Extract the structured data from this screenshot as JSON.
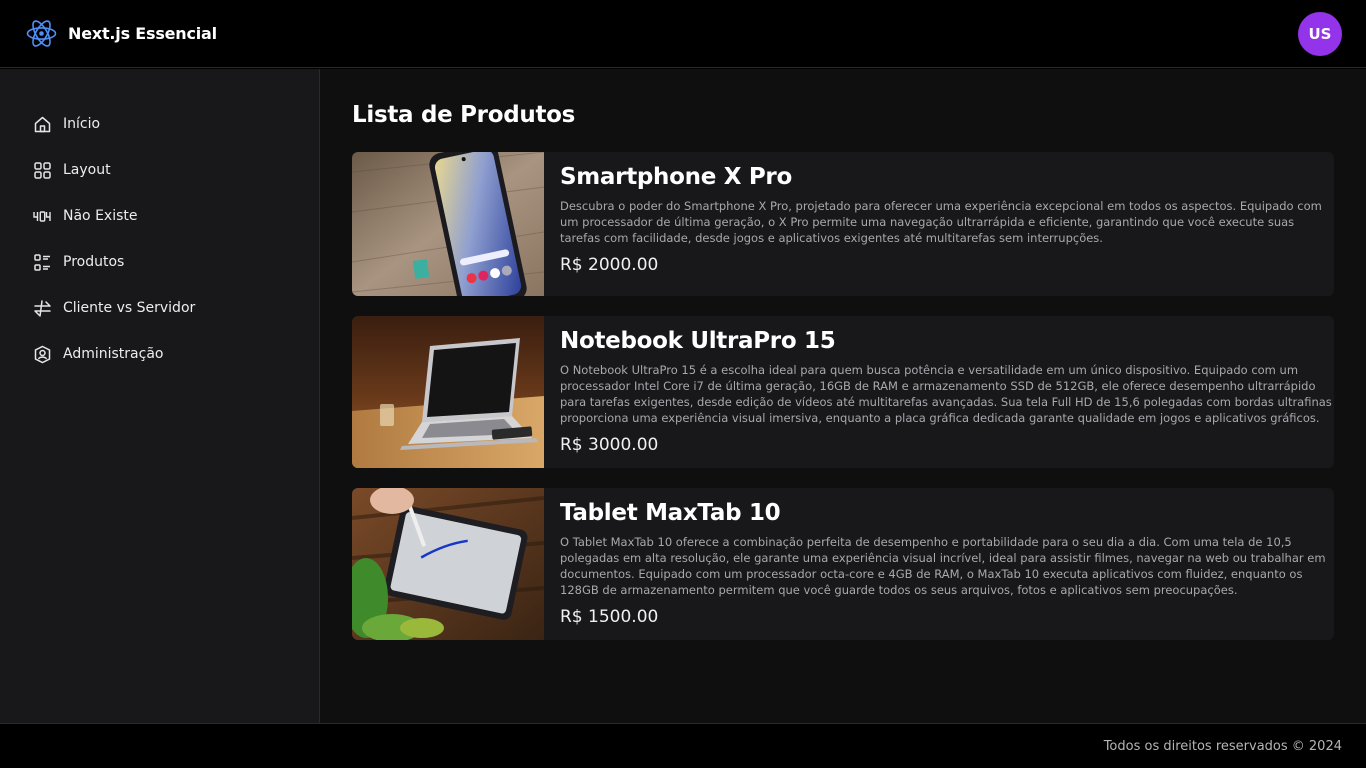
{
  "header": {
    "title": "Next.js Essencial",
    "avatar_initials": "US",
    "avatar_color": "#9333ea"
  },
  "sidebar": {
    "items": [
      {
        "label": "Início",
        "icon": "home-icon"
      },
      {
        "label": "Layout",
        "icon": "grid-icon"
      },
      {
        "label": "Não Existe",
        "icon": "404-icon"
      },
      {
        "label": "Produtos",
        "icon": "list-icon"
      },
      {
        "label": "Cliente vs Servidor",
        "icon": "arrows-exchange-icon"
      },
      {
        "label": "Administração",
        "icon": "user-shield-icon"
      }
    ]
  },
  "main": {
    "title": "Lista de Produtos",
    "products": [
      {
        "name": "Smartphone X Pro",
        "description": "Descubra o poder do Smartphone X Pro, projetado para oferecer uma experiência excepcional em todos os aspectos. Equipado com um processador de última geração, o X Pro permite uma navegação ultrarrápida e eficiente, garantindo que você execute suas tarefas com facilidade, desde jogos e aplicativos exigentes até multitarefas sem interrupções.",
        "price": "R$ 2000.00",
        "image": "smartphone-photo"
      },
      {
        "name": "Notebook UltraPro 15",
        "description": "O Notebook UltraPro 15 é a escolha ideal para quem busca potência e versatilidade em um único dispositivo. Equipado com um processador Intel Core i7 de última geração, 16GB de RAM e armazenamento SSD de 512GB, ele oferece desempenho ultrarrápido para tarefas exigentes, desde edição de vídeos até multitarefas avançadas. Sua tela Full HD de 15,6 polegadas com bordas ultrafinas proporciona uma experiência visual imersiva, enquanto a placa gráfica dedicada garante qualidade em jogos e aplicativos gráficos.",
        "price": "R$ 3000.00",
        "image": "notebook-photo"
      },
      {
        "name": "Tablet MaxTab 10",
        "description": "O Tablet MaxTab 10 oferece a combinação perfeita de desempenho e portabilidade para o seu dia a dia. Com uma tela de 10,5 polegadas em alta resolução, ele garante uma experiência visual incrível, ideal para assistir filmes, navegar na web ou trabalhar em documentos. Equipado com um processador octa-core e 4GB de RAM, o MaxTab 10 executa aplicativos com fluidez, enquanto os 128GB de armazenamento permitem que você guarde todos os seus arquivos, fotos e aplicativos sem preocupações.",
        "price": "R$ 1500.00",
        "image": "tablet-photo"
      }
    ]
  },
  "footer": {
    "text": "Todos os direitos reservados © 2024"
  }
}
